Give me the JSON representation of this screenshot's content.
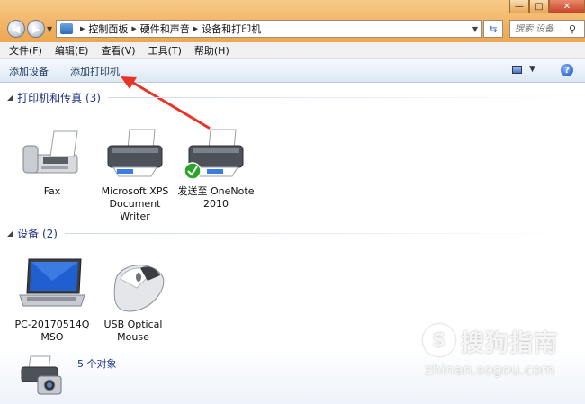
{
  "window": {
    "minimize_glyph": "—",
    "maximize_glyph": "□",
    "close_glyph": "✕"
  },
  "address_bar": {
    "breadcrumbs": [
      "控制面板",
      "硬件和声音",
      "设备和打印机"
    ]
  },
  "search": {
    "placeholder": "搜索 设备..."
  },
  "menu": {
    "items": [
      "文件(F)",
      "编辑(E)",
      "查看(V)",
      "工具(T)",
      "帮助(H)"
    ]
  },
  "commands": {
    "add_device": "添加设备",
    "add_printer": "添加打印机"
  },
  "groups": {
    "printers": {
      "title": "打印机和传真 (3)",
      "items": [
        {
          "name": "Fax",
          "icon": "fax-icon"
        },
        {
          "name_lines": [
            "Microsoft XPS",
            "Document",
            "Writer"
          ],
          "icon": "printer-icon"
        },
        {
          "name_lines": [
            "发送至 OneNote",
            "2010"
          ],
          "icon": "printer-default-icon",
          "is_default": true
        }
      ]
    },
    "devices": {
      "title": "设备 (2)",
      "items": [
        {
          "name_lines": [
            "PC-20170514Q",
            "MSO"
          ],
          "icon": "laptop-icon"
        },
        {
          "name_lines": [
            "USB Optical",
            "Mouse"
          ],
          "icon": "mouse-icon"
        }
      ]
    }
  },
  "details_pane": {
    "count": "5 个对象"
  },
  "watermark": {
    "name": "搜狗指南",
    "url": "zhinan.sogou.com",
    "logo_glyph": "S"
  },
  "annotation": {
    "arrow_color": "#e8332a",
    "points_to": "add_printer"
  }
}
